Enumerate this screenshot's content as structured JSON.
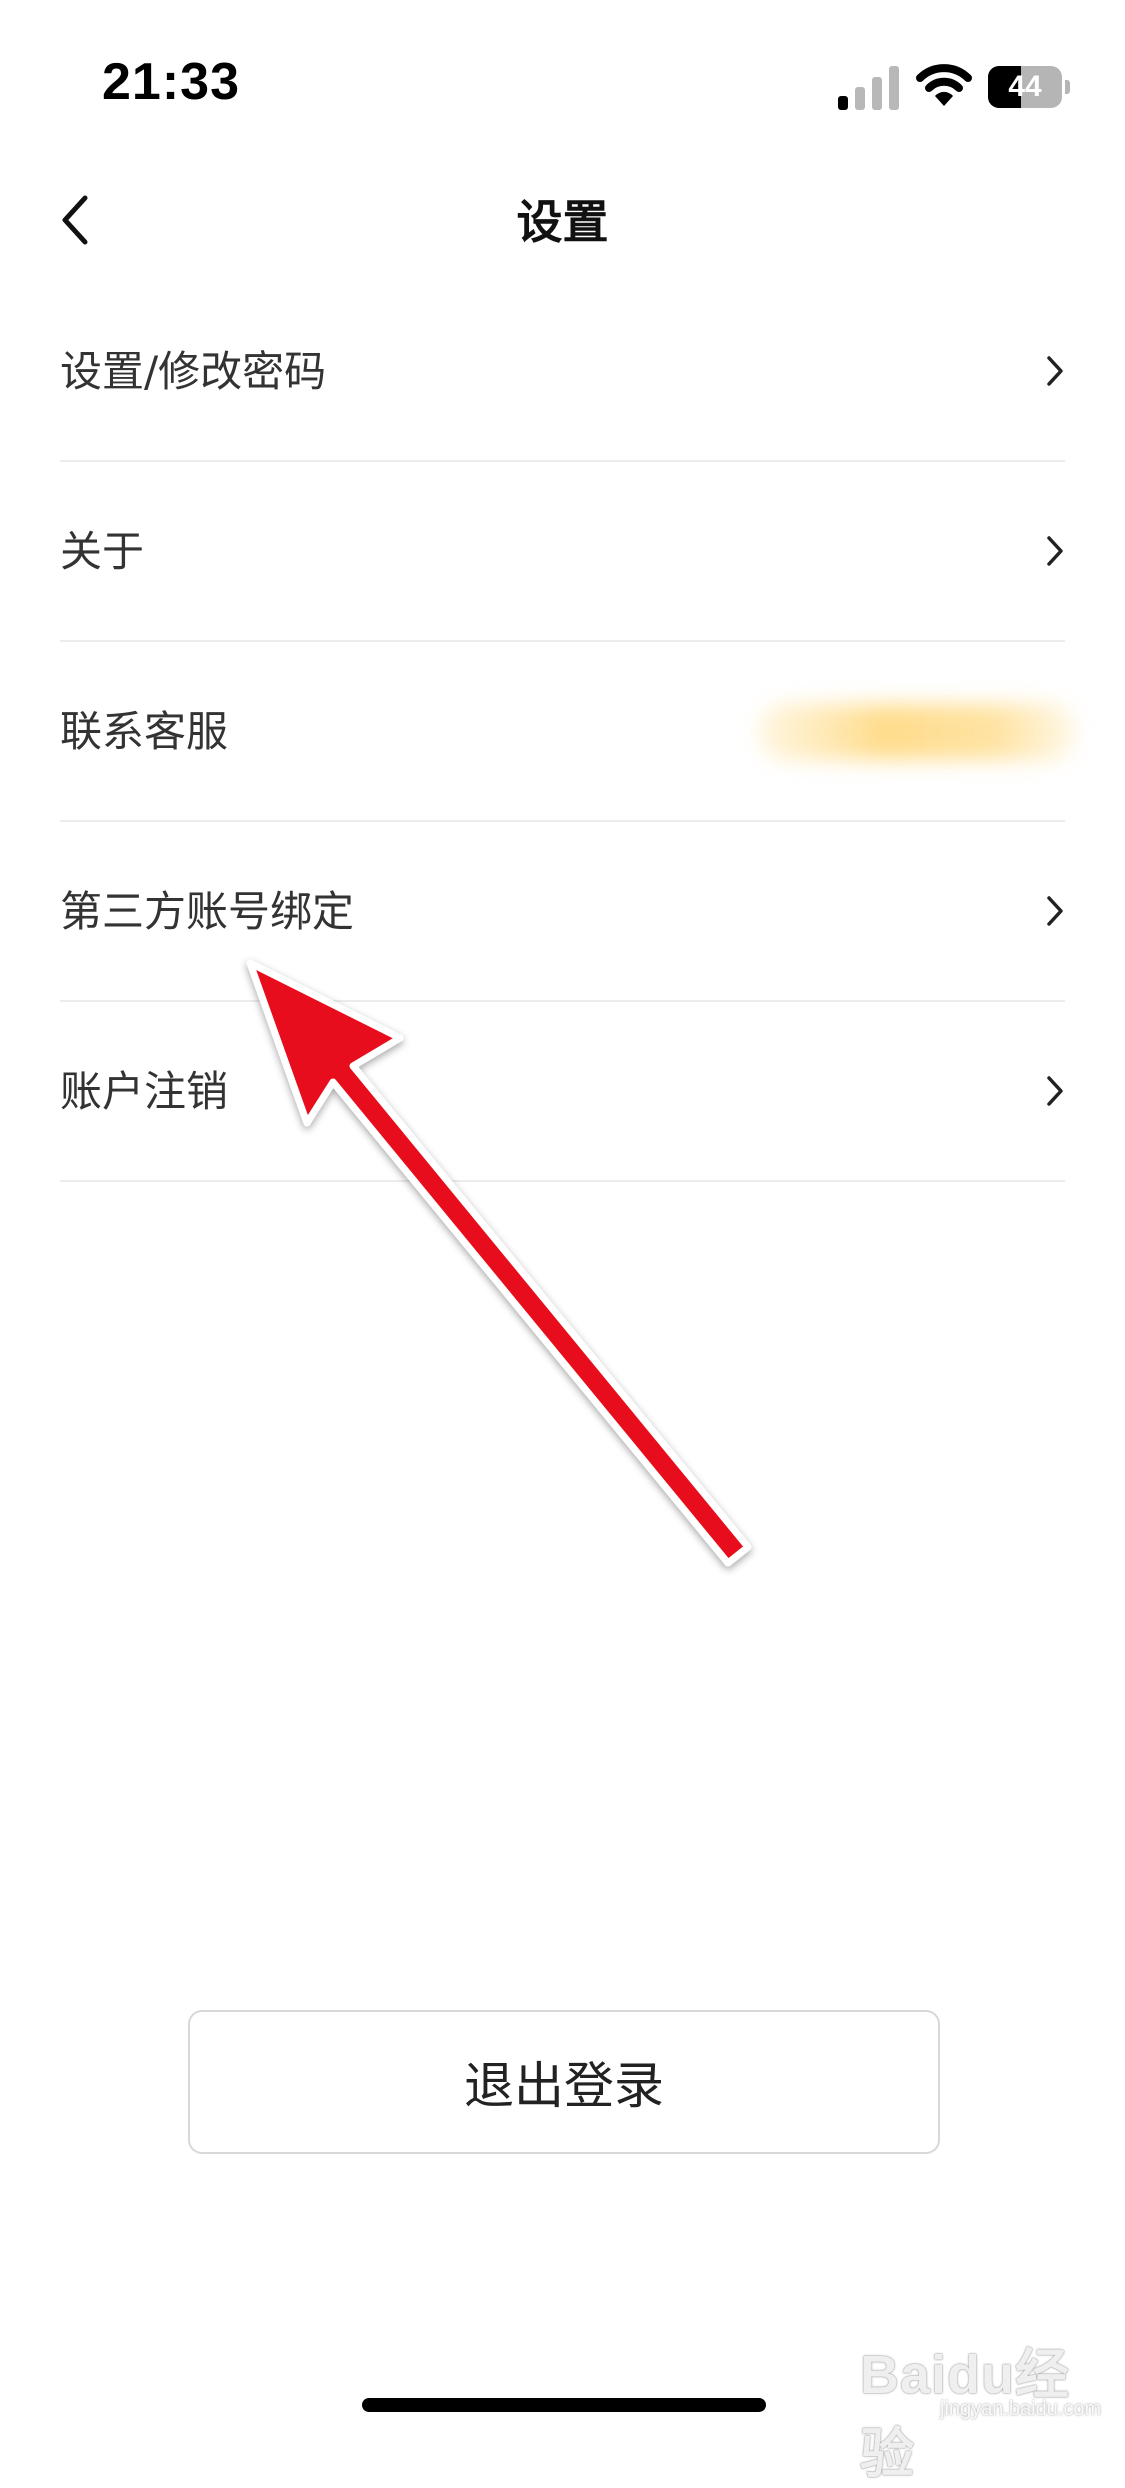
{
  "status_bar": {
    "time": "21:33",
    "battery_level": "44",
    "battery_fraction": 0.44,
    "signal_bars_active": 1,
    "signal_bars_total": 4,
    "icons": [
      "cellular-signal-icon",
      "wifi-icon",
      "battery-icon"
    ]
  },
  "nav": {
    "title": "设置",
    "back_icon": "chevron-left-icon"
  },
  "settings": {
    "items": [
      {
        "label": "设置/修改密码",
        "trailing": "chevron-right-icon"
      },
      {
        "label": "关于",
        "trailing": "chevron-right-icon"
      },
      {
        "label": "联系客服",
        "trailing": "blurred-value"
      },
      {
        "label": "第三方账号绑定",
        "trailing": "chevron-right-icon"
      },
      {
        "label": "账户注销",
        "trailing": "chevron-right-icon"
      }
    ]
  },
  "logout": {
    "label": "退出登录"
  },
  "watermark": {
    "brand": "Baidu经验",
    "url": "jingyan.baidu.com"
  },
  "colors": {
    "annotation_arrow": "#e8101a",
    "divider": "#ececec",
    "text_primary": "#333333",
    "button_border": "#d8d8d8"
  }
}
